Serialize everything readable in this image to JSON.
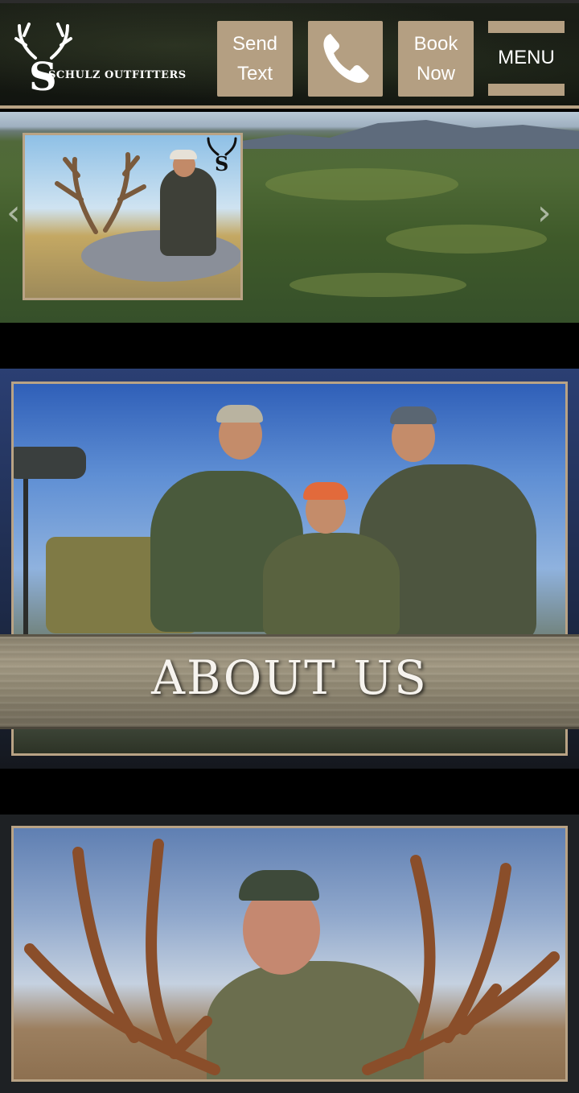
{
  "header": {
    "logo_text": "SCHULZ OUTFITTERS",
    "send_text": {
      "line1": "Send",
      "line2": "Text"
    },
    "call_icon": "phone-icon",
    "book_now": {
      "line1": "Book",
      "line2": "Now"
    },
    "menu_label": "MENU"
  },
  "hero": {
    "prev_arrow": "‹",
    "next_arrow": "›",
    "photo_icon": "deer-hunter-photo"
  },
  "about": {
    "title": "ABOUT US",
    "photo_icon": "family-hunters-photo"
  },
  "guide": {
    "photo_icon": "guide-with-antlers-photo"
  },
  "colors": {
    "accent": "#b49f82",
    "frame": "#b9a385",
    "header_bg": "#15190f"
  }
}
